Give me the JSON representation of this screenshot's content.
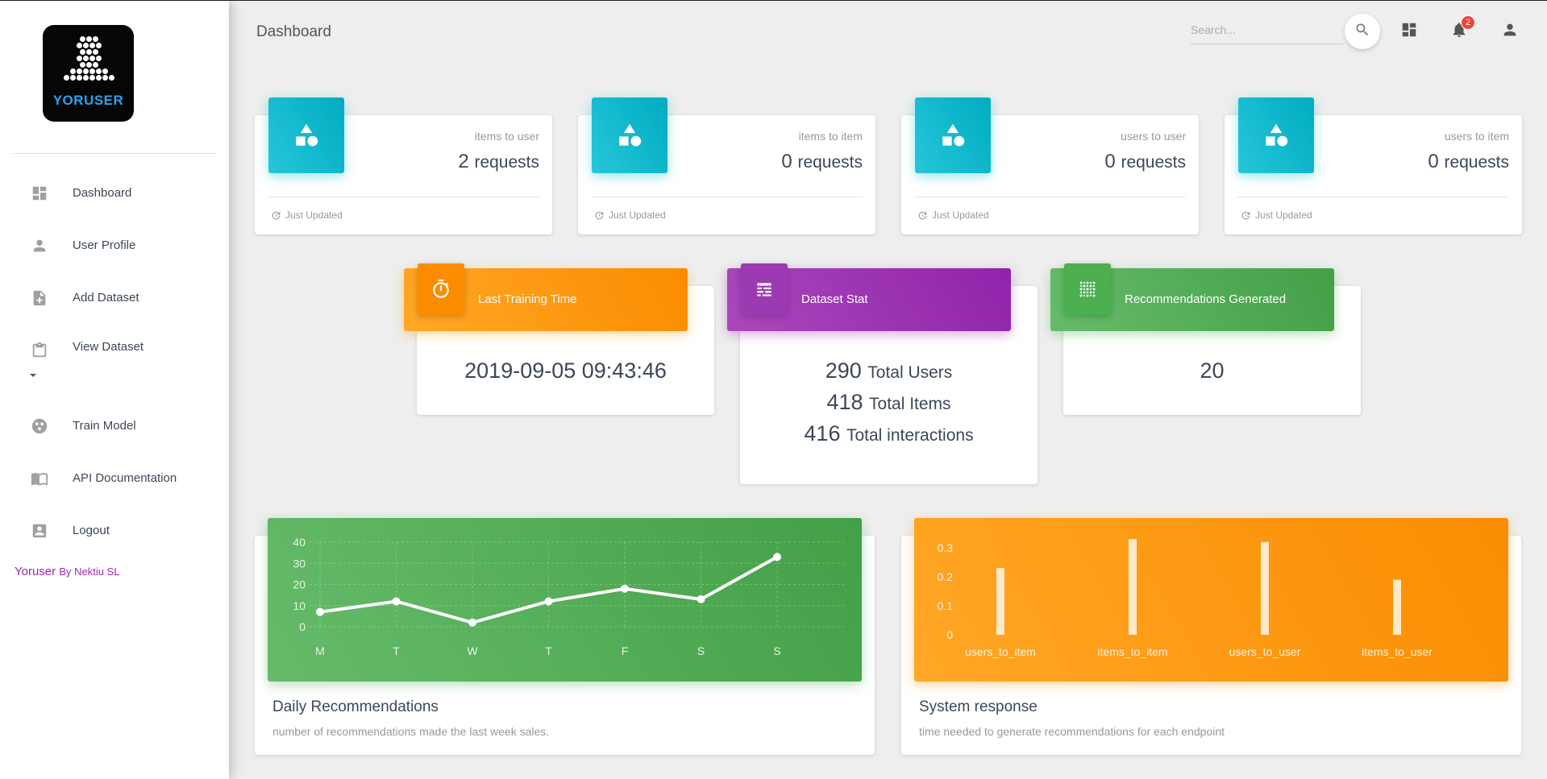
{
  "app": {
    "logo_text": "YORUSER",
    "brand": "Yoruser",
    "brand_by": "By Nektiu SL"
  },
  "sidebar": {
    "items": [
      {
        "label": "Dashboard",
        "icon": "dashboard-icon"
      },
      {
        "label": "User Profile",
        "icon": "person-icon"
      },
      {
        "label": "Add Dataset",
        "icon": "note-add-icon"
      },
      {
        "label": "View Dataset",
        "icon": "clipboard-icon"
      },
      {
        "label": "Train Model",
        "icon": "bubble-chart-icon"
      },
      {
        "label": "API Documentation",
        "icon": "book-icon"
      },
      {
        "label": "Logout",
        "icon": "account-box-icon"
      }
    ]
  },
  "header": {
    "title": "Dashboard",
    "search_placeholder": "Search...",
    "notification_count": "2"
  },
  "stats": [
    {
      "category": "items to user",
      "value": "2",
      "unit": "requests",
      "footer": "Just Updated"
    },
    {
      "category": "items to item",
      "value": "0",
      "unit": "requests",
      "footer": "Just Updated"
    },
    {
      "category": "users to user",
      "value": "0",
      "unit": "requests",
      "footer": "Just Updated"
    },
    {
      "category": "users to item",
      "value": "0",
      "unit": "requests",
      "footer": "Just Updated"
    }
  ],
  "training": {
    "title": "Last Training Time",
    "value": "2019-09-05 09:43:46"
  },
  "dataset": {
    "title": "Dataset Stat",
    "users": "290",
    "users_label": "Total Users",
    "items": "418",
    "items_label": "Total Items",
    "interactions": "416",
    "interactions_label": "Total interactions"
  },
  "recommendations": {
    "title": "Recommendations Generated",
    "value": "20"
  },
  "colors": {
    "cyan": "#00acc1",
    "orange": "#fb8c00",
    "purple": "#9c27b0",
    "green": "#4caf50"
  },
  "charts": {
    "daily": {
      "title": "Daily Recommendations",
      "subtitle": "number of recommendations made the last week sales."
    },
    "system": {
      "title": "System response",
      "subtitle": "time needed to generate recommendations for each endpoint"
    }
  },
  "chart_data": [
    {
      "type": "line",
      "categories": [
        "M",
        "T",
        "W",
        "T",
        "F",
        "S",
        "S"
      ],
      "values": [
        7,
        12,
        2,
        12,
        18,
        13,
        33
      ],
      "ylim": [
        0,
        40
      ],
      "yticks": [
        "0",
        "10",
        "20",
        "30",
        "40"
      ],
      "grid": true
    },
    {
      "type": "bar",
      "categories": [
        "users_to_item",
        "items_to_item",
        "users_to_user",
        "items_to_user"
      ],
      "values": [
        0.23,
        0.33,
        0.32,
        0.19
      ],
      "ylim": [
        0,
        0.3
      ],
      "yticks": [
        "0",
        "0.1",
        "0.2",
        "0.3"
      ],
      "grid": false
    }
  ]
}
